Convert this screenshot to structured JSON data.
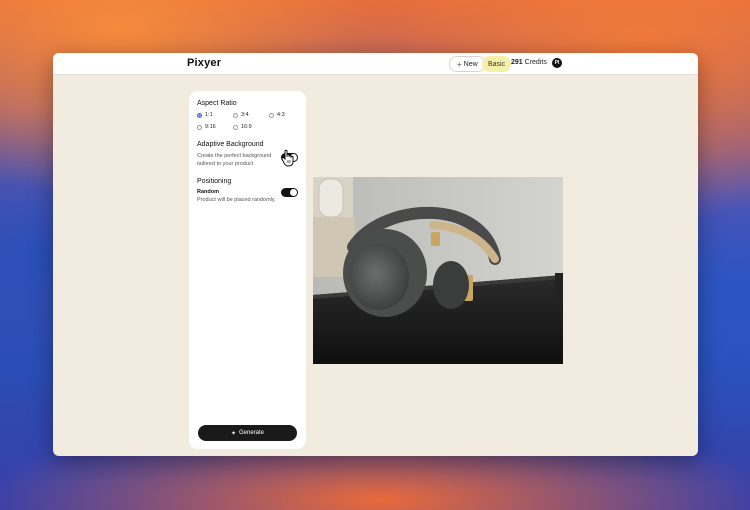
{
  "app": {
    "logo": "Pixyer",
    "new_label": "New",
    "plan_label": "Basic",
    "credits_count": "291",
    "credits_label": "Credits",
    "avatar_initials": "PI"
  },
  "panel": {
    "aspect_ratio": {
      "title": "Aspect Ratio",
      "options": [
        {
          "label": "1:1",
          "selected": true
        },
        {
          "label": "3:4",
          "selected": false
        },
        {
          "label": "4:3",
          "selected": false
        },
        {
          "label": "9:16",
          "selected": false
        },
        {
          "label": "16:9",
          "selected": false
        }
      ]
    },
    "adaptive_background": {
      "title": "Adaptive Background",
      "description_line1": "Create the perfect background",
      "description_line2": "tailored to your product"
    },
    "positioning": {
      "title": "Positioning",
      "option_label": "Random",
      "option_description": "Product will be placed randomly."
    },
    "generate_label": "Generate"
  },
  "colors": {
    "window_bg": "#f1ebe0",
    "plan_badge": "#f5f0a8",
    "toggle_on": "#111111",
    "radio_selected": "#3b6fd8"
  }
}
